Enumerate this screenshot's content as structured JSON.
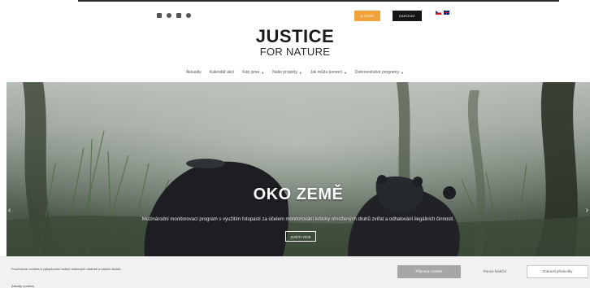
{
  "header": {
    "social_icons": [
      "facebook-icon",
      "instagram-icon",
      "youtube-icon",
      "pinterest-icon"
    ],
    "eshop_label": "E-SHOP",
    "donate_label": "DAROVAT",
    "languages": [
      "cz-flag-icon",
      "en-flag-icon"
    ],
    "logo_main": "JUSTICE",
    "logo_sub": "FOR NATURE"
  },
  "nav": {
    "items": [
      {
        "label": "Aktuality",
        "dropdown": false
      },
      {
        "label": "Kalendář akcí",
        "dropdown": false
      },
      {
        "label": "Kdo jsme",
        "dropdown": true
      },
      {
        "label": "Naše projekty",
        "dropdown": true
      },
      {
        "label": "Jak můžu pomoct",
        "dropdown": true
      },
      {
        "label": "Dobrovolnické programy",
        "dropdown": true
      }
    ]
  },
  "hero": {
    "title": "OKO ZEMĚ",
    "description": "Mezinárodní monitorovací program s využitím fotopastí za účelem monitorování kriticky ohrožených druhů zvířat a odhalování ilegálních činností.",
    "button_label": "ZJISTI VÍCE",
    "prev_icon": "chevron-left-icon",
    "next_icon": "chevron-right-icon"
  },
  "cookie": {
    "text": "Používáme cookies k vylepšování našich webových stránek a našich služeb.",
    "link_label": "Zásady cookies",
    "accept_label": "Přijmout cookies",
    "necessary_label": "Pouze funkční",
    "preferences_label": "Zobrazit předvolby"
  },
  "colors": {
    "eshop": "#f0a33c",
    "donate": "#151515",
    "accept": "#a7a7a7"
  }
}
